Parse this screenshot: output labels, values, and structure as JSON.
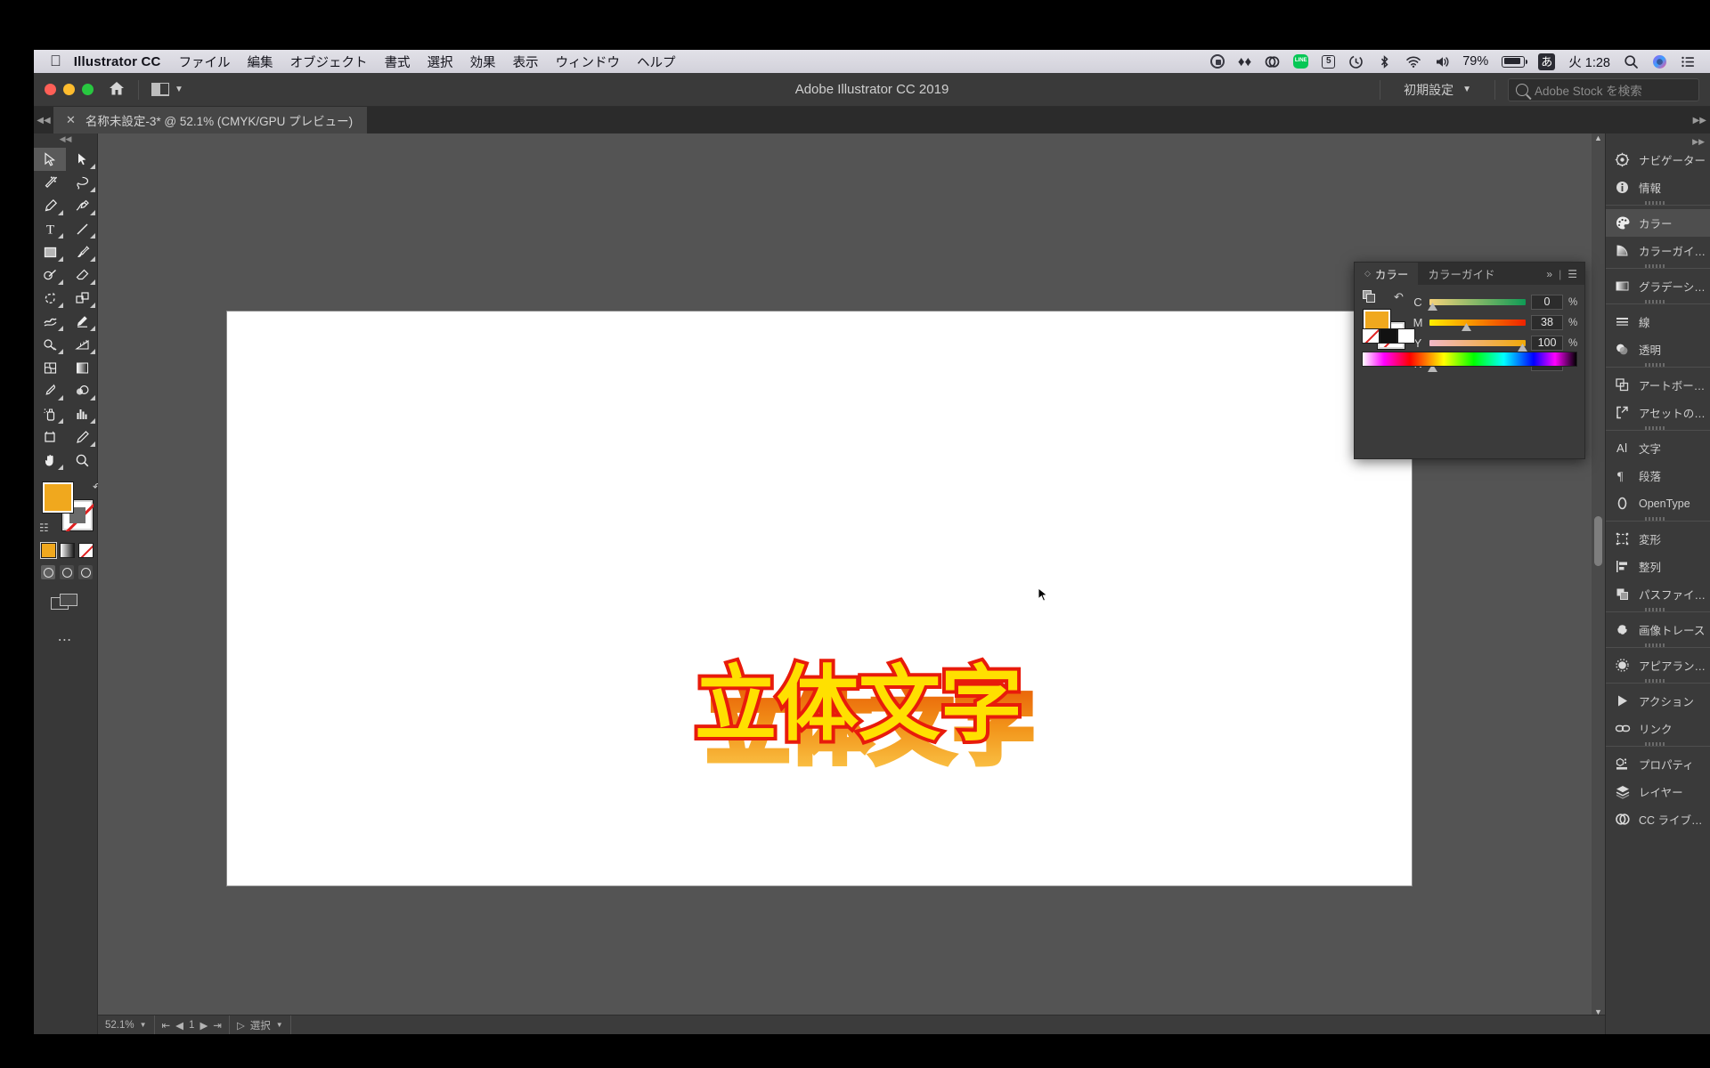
{
  "macbar": {
    "apple_icon": "apple-icon",
    "app_name": "Illustrator CC",
    "menus": [
      "ファイル",
      "編集",
      "オブジェクト",
      "書式",
      "選択",
      "効果",
      "表示",
      "ウィンドウ",
      "ヘルプ"
    ],
    "status_icons": [
      "screen-record-icon",
      "dropbox-icon",
      "creative-cloud-icon",
      "line-icon",
      "sophos-icon",
      "timemachine-icon",
      "bluetooth-icon",
      "wifi-icon",
      "volume-icon"
    ],
    "battery_percent": "79%",
    "battery_icon": "battery-icon",
    "input_method": "あ",
    "clock": "火 1:28",
    "search_icon": "spotlight-icon",
    "siri_icon": "siri-icon",
    "control_center_icon": "control-center-icon"
  },
  "titlebar": {
    "title": "Adobe Illustrator CC 2019",
    "home_icon": "home-icon",
    "arrange_icon": "arrange-documents-icon",
    "arrange_chevron": "chevron-down-icon",
    "workspace": "初期設定",
    "workspace_chevron": "chevron-down-icon",
    "stock_placeholder": "Adobe Stock を検索",
    "stock_icon": "search-icon"
  },
  "tabbar": {
    "close_icon": "close-icon",
    "document_title": "名称未設定-3* @ 52.1% (CMYK/GPU プレビュー)",
    "collapse_left_icon": "collapse-left-icon",
    "collapse_right_icon": "collapse-right-icon"
  },
  "tools": {
    "grab_icon": "panel-grabber-icon",
    "items": [
      {
        "name": "selection-tool",
        "selected": true
      },
      {
        "name": "direct-selection-tool",
        "selected": false
      },
      {
        "name": "magic-wand-tool",
        "selected": false
      },
      {
        "name": "lasso-tool",
        "selected": false
      },
      {
        "name": "pen-tool",
        "selected": false
      },
      {
        "name": "curvature-tool",
        "selected": false
      },
      {
        "name": "type-tool",
        "selected": false
      },
      {
        "name": "line-segment-tool",
        "selected": false
      },
      {
        "name": "rectangle-tool",
        "selected": false
      },
      {
        "name": "paintbrush-tool",
        "selected": false
      },
      {
        "name": "shaper-tool",
        "selected": false
      },
      {
        "name": "eraser-tool",
        "selected": false
      },
      {
        "name": "rotate-tool",
        "selected": false
      },
      {
        "name": "scale-tool",
        "selected": false
      },
      {
        "name": "width-tool",
        "selected": false
      },
      {
        "name": "free-transform-tool",
        "selected": false
      },
      {
        "name": "shape-builder-tool",
        "selected": false
      },
      {
        "name": "perspective-grid-tool",
        "selected": false
      },
      {
        "name": "mesh-tool",
        "selected": false
      },
      {
        "name": "gradient-tool",
        "selected": false
      },
      {
        "name": "eyedropper-tool",
        "selected": false
      },
      {
        "name": "blend-tool",
        "selected": false
      },
      {
        "name": "symbol-sprayer-tool",
        "selected": false
      },
      {
        "name": "column-graph-tool",
        "selected": false
      },
      {
        "name": "artboard-tool",
        "selected": false
      },
      {
        "name": "slice-tool",
        "selected": false
      },
      {
        "name": "hand-tool",
        "selected": false
      },
      {
        "name": "zoom-tool",
        "selected": false
      }
    ],
    "fill_color": "#f0a81e",
    "stroke_color": "none",
    "swap_icon": "swap-fill-stroke-icon",
    "default_icon": "default-fill-stroke-icon",
    "color_modes": [
      "color-mode",
      "gradient-mode",
      "none-mode"
    ],
    "draw_modes": [
      "draw-normal",
      "draw-behind",
      "draw-inside"
    ],
    "screen_mode_icon": "change-screen-mode-icon",
    "more_icon": "edit-toolbar-icon"
  },
  "artwork": {
    "headline_black": "立体文字",
    "headline_color": "立体文字",
    "color_fill": "#ffe000",
    "color_outline": "#e81b0b",
    "color_extrude_top": "#f08a0a",
    "color_extrude_bottom": "#f7b233"
  },
  "statusbar": {
    "zoom": "52.1%",
    "zoom_chevron": "chevron-down-icon",
    "nav_first": "first-page-icon",
    "nav_prev": "previous-page-icon",
    "artboard_number": "1",
    "nav_next": "next-page-icon",
    "nav_last": "last-page-icon",
    "artboard_nav_icon": "artboard-navigation-icon",
    "tool_label": "選択",
    "tool_chevron": "chevron-down-icon"
  },
  "color_panel": {
    "tabs": [
      {
        "label": "カラー",
        "active": true
      },
      {
        "label": "カラーガイド",
        "active": false
      }
    ],
    "expand_icon": "expand-panel-icon",
    "menu_icon": "panel-menu-icon",
    "fill_color": "#f0a81e",
    "stroke_color": "none",
    "swap_icon": "swap-fill-stroke-icon",
    "fill_stroke_icon": "fill-stroke-indicator-icon",
    "mode": "CMYK",
    "sliders": [
      {
        "label": "C",
        "value": "0",
        "unit": "%",
        "pos": 0,
        "from": "#f6d27a",
        "to": "#0f9b55"
      },
      {
        "label": "M",
        "value": "38",
        "unit": "%",
        "pos": 38,
        "from": "#ffee00",
        "to": "#ee2200"
      },
      {
        "label": "Y",
        "value": "100",
        "unit": "%",
        "pos": 100,
        "from": "#f0b7c6",
        "to": "#f0aa08"
      },
      {
        "label": "K",
        "value": "0",
        "unit": "%",
        "pos": 0,
        "from": "#f0b41e",
        "to": "#201000"
      }
    ],
    "bottom_swatches": [
      "none-swatch",
      "black-swatch",
      "white-swatch"
    ],
    "spectrum": "color-spectrum-ramp"
  },
  "dock": {
    "collapse_icon": "collapse-dock-icon",
    "groups": [
      [
        {
          "label": "ナビゲーター",
          "icon": "navigator-icon",
          "active": false
        },
        {
          "label": "情報",
          "icon": "info-icon",
          "active": false
        }
      ],
      [
        {
          "label": "カラー",
          "icon": "color-icon",
          "active": true
        },
        {
          "label": "カラーガイ…",
          "icon": "color-guide-icon",
          "active": false
        }
      ],
      [
        {
          "label": "グラデーシ…",
          "icon": "gradient-icon",
          "active": false
        }
      ],
      [
        {
          "label": "線",
          "icon": "stroke-icon",
          "active": false
        },
        {
          "label": "透明",
          "icon": "transparency-icon",
          "active": false
        }
      ],
      [
        {
          "label": "アートボー…",
          "icon": "artboards-icon",
          "active": false
        },
        {
          "label": "アセットの…",
          "icon": "asset-export-icon",
          "active": false
        }
      ],
      [
        {
          "label": "文字",
          "icon": "character-icon",
          "active": false
        },
        {
          "label": "段落",
          "icon": "paragraph-icon",
          "active": false
        },
        {
          "label": "OpenType",
          "icon": "opentype-icon",
          "active": false
        }
      ],
      [
        {
          "label": "変形",
          "icon": "transform-icon",
          "active": false
        },
        {
          "label": "整列",
          "icon": "align-icon",
          "active": false
        },
        {
          "label": "パスファイ…",
          "icon": "pathfinder-icon",
          "active": false
        }
      ],
      [
        {
          "label": "画像トレース",
          "icon": "image-trace-icon",
          "active": false
        }
      ],
      [
        {
          "label": "アピアラン…",
          "icon": "appearance-icon",
          "active": false
        }
      ],
      [
        {
          "label": "アクション",
          "icon": "actions-icon",
          "active": false
        },
        {
          "label": "リンク",
          "icon": "links-icon",
          "active": false
        }
      ],
      [
        {
          "label": "プロパティ",
          "icon": "properties-icon",
          "active": false
        },
        {
          "label": "レイヤー",
          "icon": "layers-icon",
          "active": false
        },
        {
          "label": "CC ライブ…",
          "icon": "cc-libraries-icon",
          "active": false
        }
      ]
    ]
  }
}
